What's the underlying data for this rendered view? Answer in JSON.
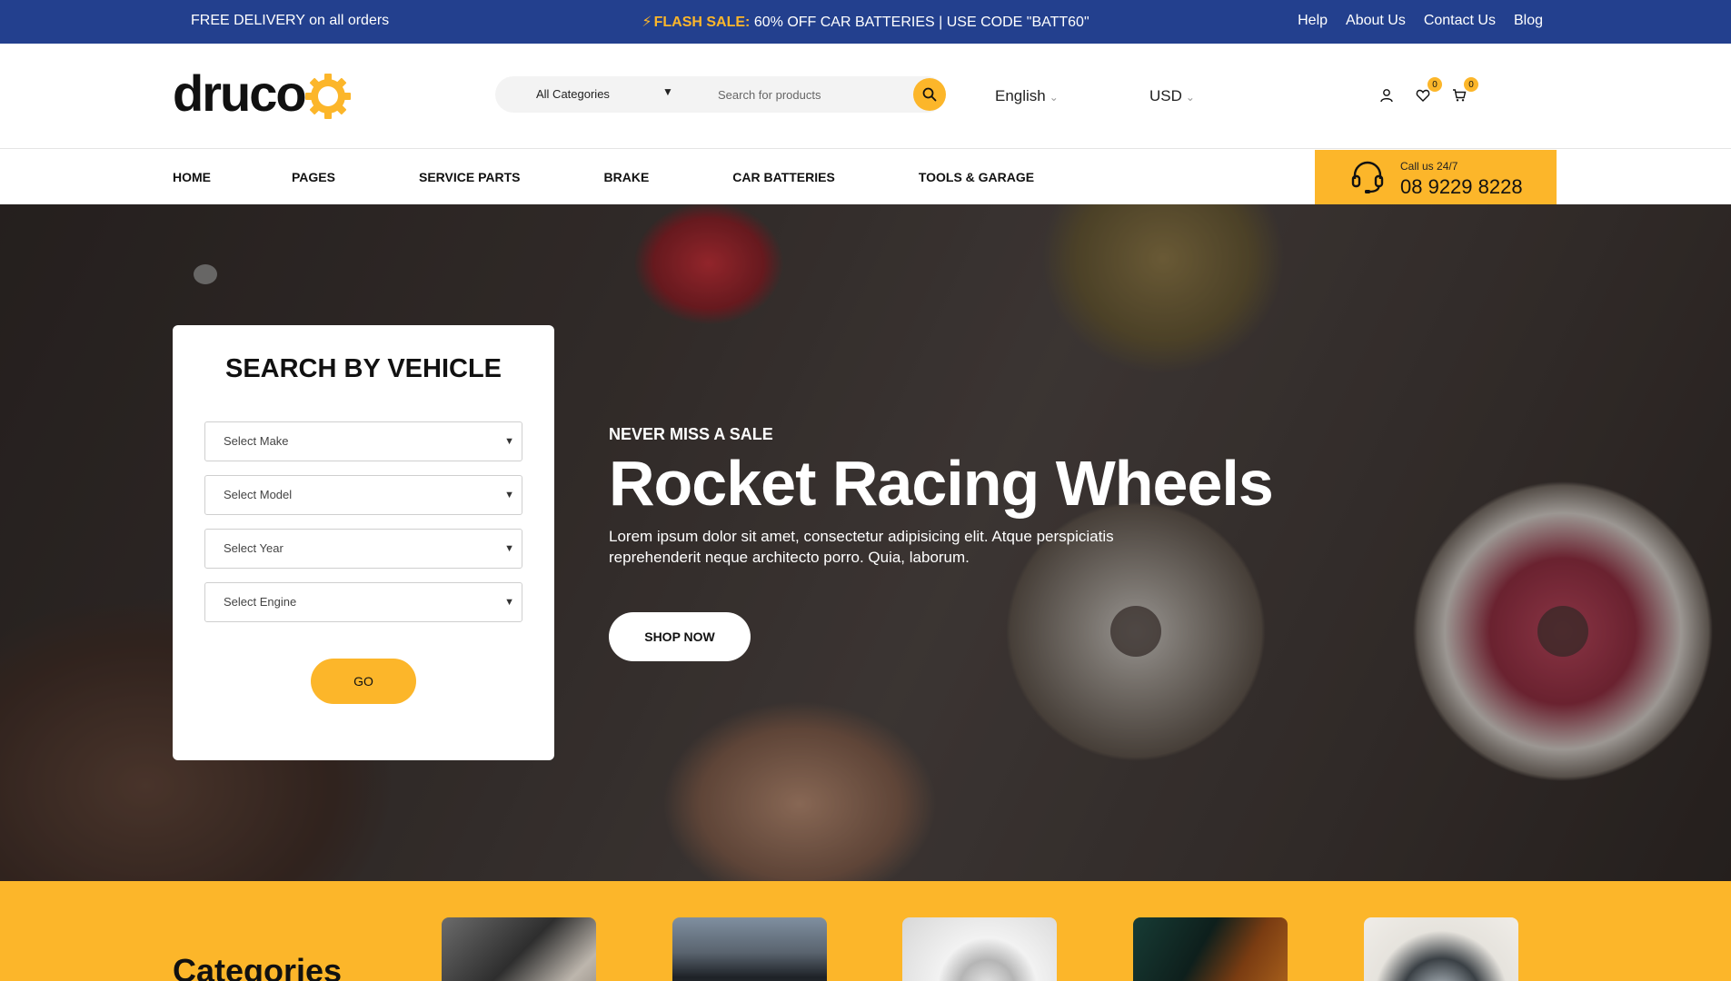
{
  "topbar": {
    "free_delivery": "FREE DELIVERY on all orders",
    "flash_label": "FLASH SALE:",
    "flash_text": "60% OFF CAR BATTERIES | USE CODE \"BATT60\"",
    "links": [
      "Help",
      "About Us",
      "Contact Us",
      "Blog"
    ]
  },
  "header": {
    "logo": "druco",
    "search": {
      "category": "All Categories",
      "placeholder": "Search for products"
    },
    "language": "English",
    "currency": "USD",
    "wishlist_count": "0",
    "cart_count": "0"
  },
  "nav": {
    "items": [
      "HOME",
      "PAGES",
      "SERVICE PARTS",
      "BRAKE",
      "CAR BATTERIES",
      "TOOLS & GARAGE"
    ],
    "call_label": "Call us 24/7",
    "call_number": "08 9229 8228"
  },
  "vehicle_search": {
    "title": "SEARCH BY VEHICLE",
    "make": "Select Make",
    "model": "Select Model",
    "year": "Select Year",
    "engine": "Select Engine",
    "go": "GO"
  },
  "hero": {
    "eyebrow": "NEVER MISS A SALE",
    "title": "Rocket Racing Wheels",
    "description": "Lorem ipsum dolor sit amet, consectetur adipisicing elit. Atque perspiciatis reprehenderit neque architecto porro. Quia, laborum.",
    "cta": "SHOP NOW"
  },
  "categories": {
    "title": "Categories"
  },
  "colors": {
    "topbar": "#23408e",
    "accent": "#fcb62a"
  }
}
